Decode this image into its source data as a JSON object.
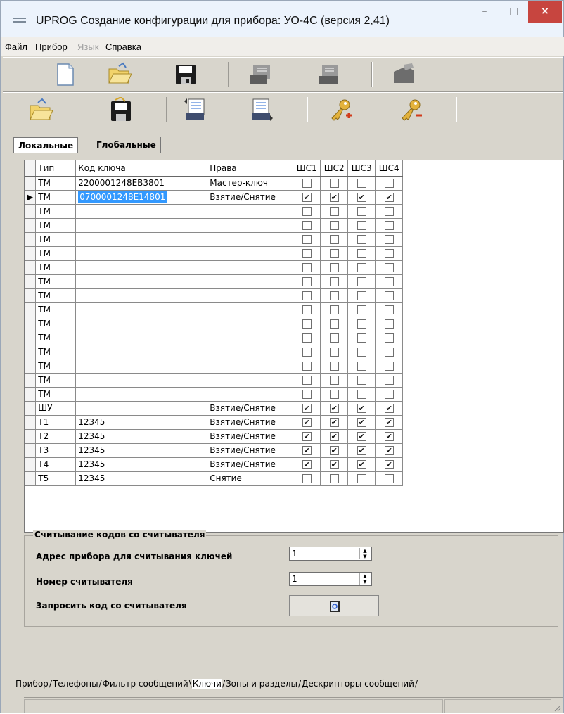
{
  "window": {
    "title": "UPROG  Создание конфигурации для прибора: УО-4С (версия  2,41)",
    "minimize": "–",
    "maximize": "□",
    "close": "×"
  },
  "menu": [
    {
      "label": "Файл",
      "enabled": true
    },
    {
      "label": "Прибор",
      "enabled": true
    },
    {
      "label": "Язык",
      "enabled": false
    },
    {
      "label": "Справка",
      "enabled": true
    }
  ],
  "toolbar1": [
    "new-file-icon",
    "open-folder-icon",
    "save-disk-icon",
    "export-config-icon",
    "import-config-icon",
    "device-write-icon"
  ],
  "toolbar2": [
    "open-keys-icon",
    "save-keys-icon",
    "upload-keys-icon",
    "download-keys-icon",
    "add-key-icon",
    "remove-key-icon"
  ],
  "top_tabs": [
    {
      "label": "Локальные",
      "active": true
    },
    {
      "label": "Глобальные",
      "active": false
    }
  ],
  "grid": {
    "headers": [
      "Тип",
      "Код ключа",
      "Права",
      "ШС1",
      "ШС2",
      "ШС3",
      "ШС4"
    ],
    "rows": [
      {
        "type": "TM",
        "code": "2200001248EB3801",
        "rights": "Мастер-ключ",
        "checks": [
          false,
          false,
          false,
          false
        ],
        "current": false,
        "selected": false
      },
      {
        "type": "TM",
        "code": "0700001248E14801",
        "rights": "Взятие/Снятие",
        "checks": [
          true,
          true,
          true,
          true
        ],
        "current": true,
        "selected": true
      },
      {
        "type": "TM",
        "code": "",
        "rights": "",
        "checks": [
          false,
          false,
          false,
          false
        ],
        "current": false,
        "selected": false
      },
      {
        "type": "TM",
        "code": "",
        "rights": "",
        "checks": [
          false,
          false,
          false,
          false
        ],
        "current": false,
        "selected": false
      },
      {
        "type": "TM",
        "code": "",
        "rights": "",
        "checks": [
          false,
          false,
          false,
          false
        ],
        "current": false,
        "selected": false
      },
      {
        "type": "TM",
        "code": "",
        "rights": "",
        "checks": [
          false,
          false,
          false,
          false
        ],
        "current": false,
        "selected": false
      },
      {
        "type": "TM",
        "code": "",
        "rights": "",
        "checks": [
          false,
          false,
          false,
          false
        ],
        "current": false,
        "selected": false
      },
      {
        "type": "TM",
        "code": "",
        "rights": "",
        "checks": [
          false,
          false,
          false,
          false
        ],
        "current": false,
        "selected": false
      },
      {
        "type": "TM",
        "code": "",
        "rights": "",
        "checks": [
          false,
          false,
          false,
          false
        ],
        "current": false,
        "selected": false
      },
      {
        "type": "TM",
        "code": "",
        "rights": "",
        "checks": [
          false,
          false,
          false,
          false
        ],
        "current": false,
        "selected": false
      },
      {
        "type": "TM",
        "code": "",
        "rights": "",
        "checks": [
          false,
          false,
          false,
          false
        ],
        "current": false,
        "selected": false
      },
      {
        "type": "TM",
        "code": "",
        "rights": "",
        "checks": [
          false,
          false,
          false,
          false
        ],
        "current": false,
        "selected": false
      },
      {
        "type": "TM",
        "code": "",
        "rights": "",
        "checks": [
          false,
          false,
          false,
          false
        ],
        "current": false,
        "selected": false
      },
      {
        "type": "TM",
        "code": "",
        "rights": "",
        "checks": [
          false,
          false,
          false,
          false
        ],
        "current": false,
        "selected": false
      },
      {
        "type": "TM",
        "code": "",
        "rights": "",
        "checks": [
          false,
          false,
          false,
          false
        ],
        "current": false,
        "selected": false
      },
      {
        "type": "TM",
        "code": "",
        "rights": "",
        "checks": [
          false,
          false,
          false,
          false
        ],
        "current": false,
        "selected": false
      },
      {
        "type": "ШУ",
        "code": "",
        "rights": "Взятие/Снятие",
        "checks": [
          true,
          true,
          true,
          true
        ],
        "current": false,
        "selected": false
      },
      {
        "type": "T1",
        "code": "12345",
        "rights": "Взятие/Снятие",
        "checks": [
          true,
          true,
          true,
          true
        ],
        "current": false,
        "selected": false
      },
      {
        "type": "T2",
        "code": "12345",
        "rights": "Взятие/Снятие",
        "checks": [
          true,
          true,
          true,
          true
        ],
        "current": false,
        "selected": false
      },
      {
        "type": "T3",
        "code": "12345",
        "rights": "Взятие/Снятие",
        "checks": [
          true,
          true,
          true,
          true
        ],
        "current": false,
        "selected": false
      },
      {
        "type": "T4",
        "code": "12345",
        "rights": "Взятие/Снятие",
        "checks": [
          true,
          true,
          true,
          true
        ],
        "current": false,
        "selected": false
      },
      {
        "type": "T5",
        "code": "12345",
        "rights": "Снятие",
        "checks": [
          false,
          false,
          false,
          false
        ],
        "current": false,
        "selected": false
      }
    ]
  },
  "reader": {
    "legend": "Считывание кодов со считывателя",
    "address_label": "Адрес прибора для считывания ключей",
    "address_value": "1",
    "reader_label": "Номер считывателя",
    "reader_value": "1",
    "request_label": "Запросить код со считывателя"
  },
  "bottom_tabs": [
    {
      "label": "Прибор",
      "active": false
    },
    {
      "label": "Телефоны",
      "active": false
    },
    {
      "label": "Фильтр сообщений",
      "active": false
    },
    {
      "label": "Ключи",
      "active": true
    },
    {
      "label": "Зоны и разделы",
      "active": false
    },
    {
      "label": "Дескрипторы сообщений",
      "active": false
    }
  ]
}
